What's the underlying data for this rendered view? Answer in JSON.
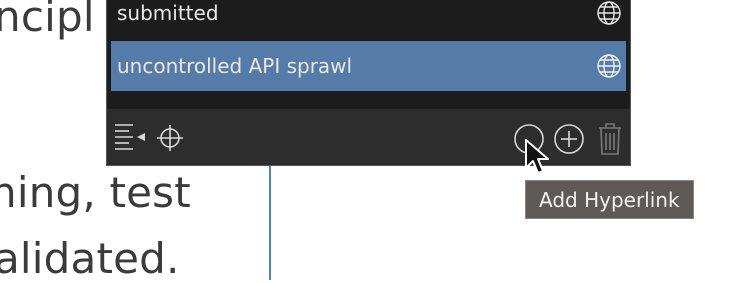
{
  "document": {
    "line_1": "ncipl",
    "line_2": "ning, test",
    "line_3": "alidated."
  },
  "panel": {
    "rows": [
      {
        "label": "submitted",
        "icon": "globe-icon"
      },
      {
        "label": "uncontrolled API sprawl",
        "icon": "globe-icon",
        "selected": true
      }
    ],
    "toolbar": {
      "left_icons": [
        "sort-list-icon",
        "crosshair-icon"
      ],
      "right_icons": [
        "circle-icon",
        "add-circle-icon",
        "trash-icon"
      ]
    }
  },
  "tooltip": {
    "text": "Add Hyperlink"
  },
  "colors": {
    "selection": "#557ba8",
    "panel_bg": "#1f1f1f",
    "tooltip_bg": "#5e5a58",
    "caret": "#4f7fcf"
  }
}
